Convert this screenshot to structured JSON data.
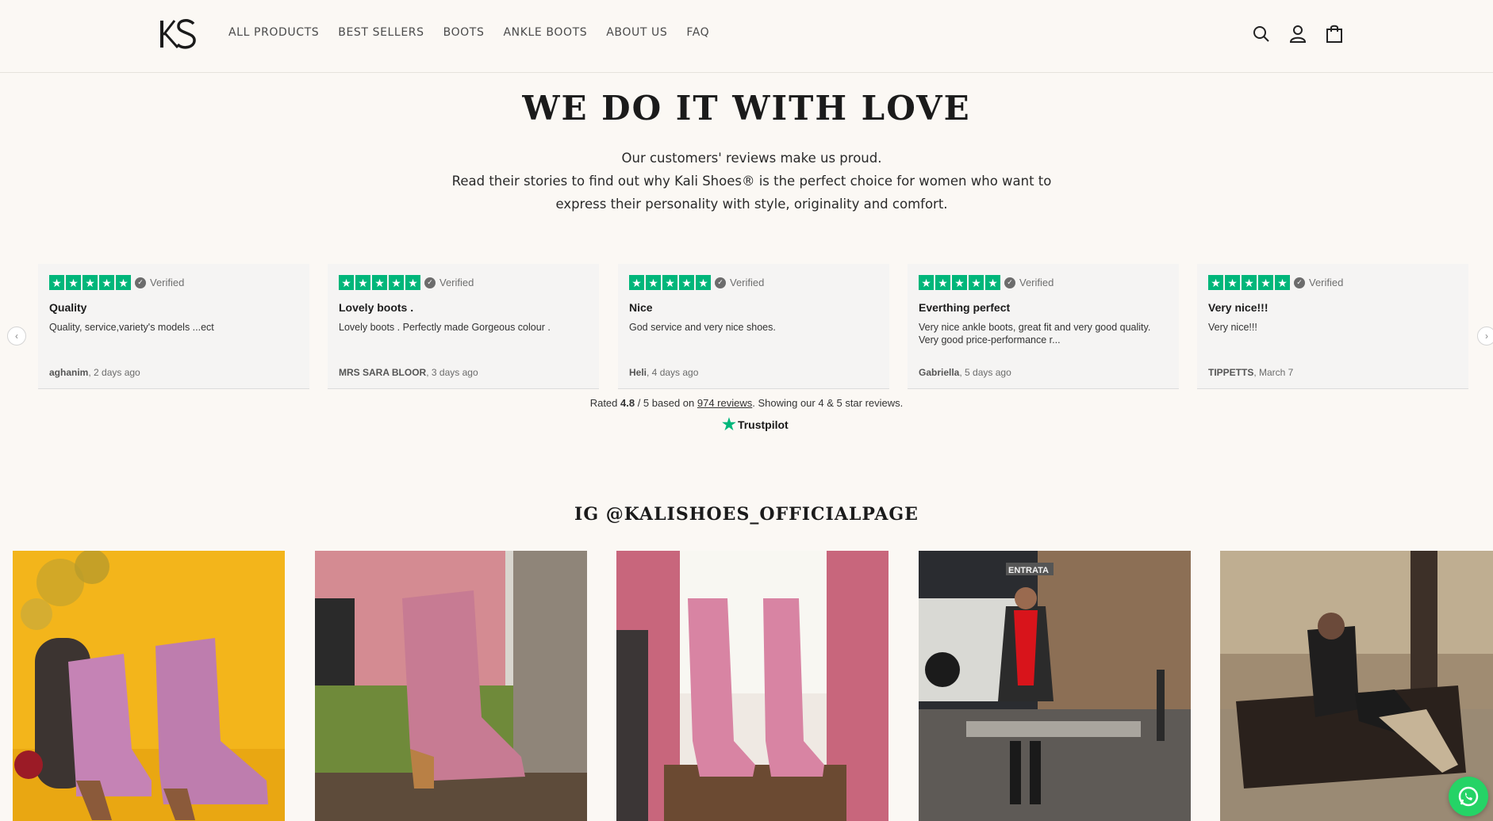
{
  "header": {
    "logo_icon": "ks-monogram-logo",
    "nav": [
      {
        "label": "ALL PRODUCTS"
      },
      {
        "label": "BEST SELLERS"
      },
      {
        "label": "BOOTS"
      },
      {
        "label": "ANKLE BOOTS"
      },
      {
        "label": "ABOUT US"
      },
      {
        "label": "FAQ"
      }
    ],
    "icons": [
      "search-icon",
      "account-icon",
      "cart-icon"
    ]
  },
  "hero": {
    "title": "WE DO IT WITH LOVE",
    "line1": "Our customers' reviews make us proud.",
    "line2": "Read their stories to find out why Kali Shoes® is the perfect choice for women who want to express their personality with style, originality and comfort."
  },
  "reviews": {
    "verified_label": "Verified",
    "items": [
      {
        "title": "Quality",
        "text": "Quality, service,variety's models ...ect",
        "author": "aghanim",
        "date": ", 2 days ago"
      },
      {
        "title": "Lovely boots .",
        "text": "Lovely boots . Perfectly made Gorgeous colour .",
        "author": "MRS SARA BLOOR",
        "date": ", 3 days ago"
      },
      {
        "title": "Nice",
        "text": "God service and very nice shoes.",
        "author": "Heli",
        "date": ", 4 days ago"
      },
      {
        "title": "Everthing perfect",
        "text": "Very nice ankle boots, great fit and very good quality. Very good price-performance r...",
        "author": "Gabriella",
        "date": ", 5 days ago"
      },
      {
        "title": "Very nice!!!",
        "text": "Very nice!!!",
        "author": "TIPPETTS",
        "date": ", March 7"
      }
    ],
    "rated_prefix": "Rated ",
    "rating": "4.8",
    "rated_mid": " / 5 based on ",
    "reviews_count": "974 reviews",
    "rated_suffix": ". Showing our 4 & 5 star reviews.",
    "brand": "Trustpilot",
    "accent_color": "#00b67a"
  },
  "instagram": {
    "title": "IG @KALISHOES_OFFICIALPAGE",
    "bus_sign": "ENTRATA"
  },
  "whatsapp_icon": "whatsapp-icon"
}
